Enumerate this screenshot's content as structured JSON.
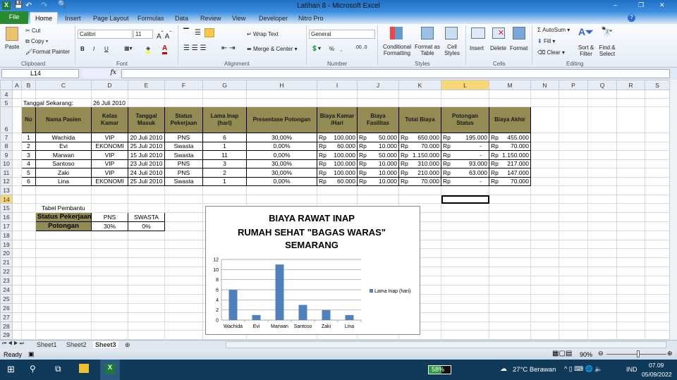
{
  "window": {
    "title": "Latihan 8  -  Microsoft Excel",
    "minimize": "–",
    "restore": "❐",
    "close": "✕"
  },
  "ribbon_tabs": [
    "File",
    "Home",
    "Insert",
    "Page Layout",
    "Formulas",
    "Data",
    "Review",
    "View",
    "Developer",
    "Nitro Pro"
  ],
  "ribbon": {
    "clipboard": {
      "group": "Clipboard",
      "paste": "Paste",
      "cut": "Cut",
      "copy": "Copy",
      "format_painter": "Format Painter"
    },
    "font": {
      "group": "Font",
      "name": "Calibri",
      "size": "11",
      "bold": "B",
      "italic": "I",
      "underline": "U"
    },
    "alignment": {
      "group": "Alignment",
      "wrap": "Wrap Text",
      "merge": "Merge & Center"
    },
    "number": {
      "group": "Number",
      "format": "General",
      "percent": "%",
      "comma": ","
    },
    "styles": {
      "group": "Styles",
      "conditional": "Conditional Formatting",
      "format_table": "Format as Table",
      "cell_styles": "Cell Styles"
    },
    "cells": {
      "group": "Cells",
      "insert": "Insert",
      "delete": "Delete",
      "format": "Format"
    },
    "editing": {
      "group": "Editing",
      "autosum": "AutoSum",
      "fill": "Fill",
      "clear": "Clear",
      "sort": "Sort & Filter",
      "find": "Find & Select"
    }
  },
  "formula_bar": {
    "name_box": "L14",
    "fx": "fx",
    "value": ""
  },
  "columns": [
    "A",
    "B",
    "C",
    "D",
    "E",
    "F",
    "G",
    "H",
    "I",
    "J",
    "K",
    "L",
    "M",
    "N",
    "P",
    "Q",
    "R",
    "S"
  ],
  "selected_cell": "L14",
  "sheet": {
    "date_label": "Tanggal Sekarang:",
    "date_value": "26 Juli 2010",
    "headers": [
      "No",
      "Nama Pasien",
      "Kelas Kamar",
      "Tanggal Masuk",
      "Status Pekerjaan",
      "Lama Inap (hari)",
      "Presentase Potongan",
      "Biaya Kamar /Hari",
      "Biaya Fasilitas",
      "Total Biaya",
      "Potongan Status",
      "Biaya Akhir"
    ],
    "currency": "Rp",
    "rows": [
      [
        "1",
        "Wachida",
        "VIP",
        "20 Juli 2010",
        "PNS",
        "6",
        "30,00%",
        "100.000",
        "50.000",
        "650.000",
        "195.000",
        "455.000"
      ],
      [
        "2",
        "Evi",
        "EKONOMI",
        "25 Juli 2010",
        "Swasta",
        "1",
        "0,00%",
        "60.000",
        "10.000",
        "70.000",
        "-",
        "70.000"
      ],
      [
        "3",
        "Marwan",
        "VIP",
        "15 Juli 2010",
        "Swasta",
        "11",
        "0,00%",
        "100.000",
        "50.000",
        "1.150.000",
        "-",
        "1.150.000"
      ],
      [
        "4",
        "Santoso",
        "VIP",
        "23 Juli 2010",
        "PNS",
        "3",
        "30,00%",
        "100.000",
        "10.000",
        "310.000",
        "93.000",
        "217.000"
      ],
      [
        "5",
        "Zaki",
        "VIP",
        "24 Juli 2010",
        "PNS",
        "2",
        "30,00%",
        "100.000",
        "10.000",
        "210.000",
        "63.000",
        "147.000"
      ],
      [
        "6",
        "Lina",
        "EKONOMI",
        "25 Juli 2010",
        "Swasta",
        "1",
        "0,00%",
        "60.000",
        "10.000",
        "70.000",
        "-",
        "70.000"
      ]
    ],
    "helper": {
      "title": "Tabel Pembantu",
      "row1": [
        "Status Pekerjaan",
        "PNS",
        "SWASTA"
      ],
      "row2": [
        "Potongan",
        "30%",
        "0%"
      ]
    }
  },
  "chart_data": {
    "type": "bar",
    "title": [
      "BIAYA RAWAT INAP",
      "RUMAH SEHAT \"BAGAS WARAS\"",
      "SEMARANG"
    ],
    "categories": [
      "Wachida",
      "Evi",
      "Marwan",
      "Santoso",
      "Zaki",
      "Lina"
    ],
    "series": [
      {
        "name": "Lama Inap (hari)",
        "values": [
          6,
          1,
          11,
          3,
          2,
          1
        ],
        "color": "#4f81bd"
      }
    ],
    "ylim": [
      0,
      12
    ],
    "yticks": [
      0,
      2,
      4,
      6,
      8,
      10,
      12
    ],
    "grid": true,
    "legend": "right"
  },
  "sheet_tabs": [
    "Sheet1",
    "Sheet2",
    "Sheet3"
  ],
  "active_sheet": "Sheet3",
  "status": {
    "ready": "Ready",
    "zoom": "90%"
  },
  "taskbar": {
    "battery": "58%",
    "weather": "27°C  Berawan",
    "lang": "IND",
    "time": "07.09",
    "date": "05/09/2022"
  }
}
